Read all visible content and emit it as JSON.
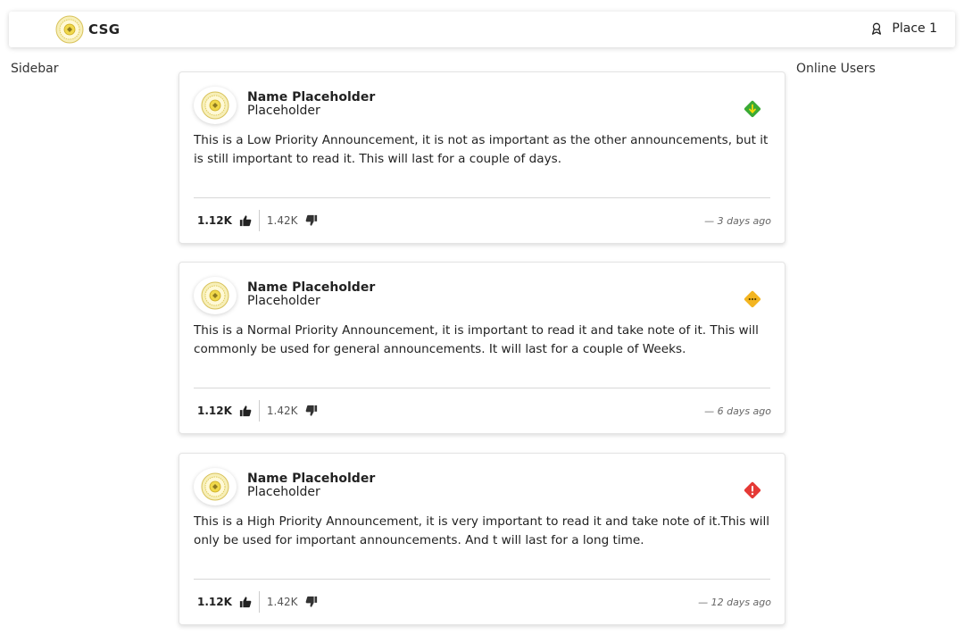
{
  "navbar": {
    "brand": "CSG",
    "place_label": "Place 1"
  },
  "layout_labels": {
    "sidebar": "Sidebar",
    "online_users": "Online Users"
  },
  "posts": [
    {
      "author_name": "Name Placeholder",
      "author_sub": "Placeholder",
      "priority": "low",
      "priority_color": "#3aaa35",
      "body": "This is a Low Priority Announcement, it is not as important as the other announcements, but it is still important to read it. This will last for a couple of days.",
      "likes": "1.12K",
      "dislikes": "1.42K",
      "time": "— 3 days ago"
    },
    {
      "author_name": "Name Placeholder",
      "author_sub": "Placeholder",
      "priority": "normal",
      "priority_color": "#f3b521",
      "body": "This is a Normal Priority Announcement, it is important to read it and take note of it. This will commonly be used for general announcements. It will last for a couple of Weeks.",
      "likes": "1.12K",
      "dislikes": "1.42K",
      "time": "— 6 days ago"
    },
    {
      "author_name": "Name Placeholder",
      "author_sub": "Placeholder",
      "priority": "high",
      "priority_color": "#e53935",
      "body": "This is a High Priority Announcement, it is very important to read it and take note of it.This will only be used for important announcements. And t will last for a long time.",
      "likes": "1.12K",
      "dislikes": "1.42K",
      "time": "— 12 days ago"
    }
  ],
  "icons": {
    "logo": "seal-logo-icon",
    "place": "badge-ribbon-icon",
    "like": "thumbs-up-icon",
    "dislike": "thumbs-down-icon",
    "low_priority": "diamond-arrow-down-icon",
    "normal_priority": "diamond-dots-icon",
    "high_priority": "diamond-exclamation-icon"
  }
}
